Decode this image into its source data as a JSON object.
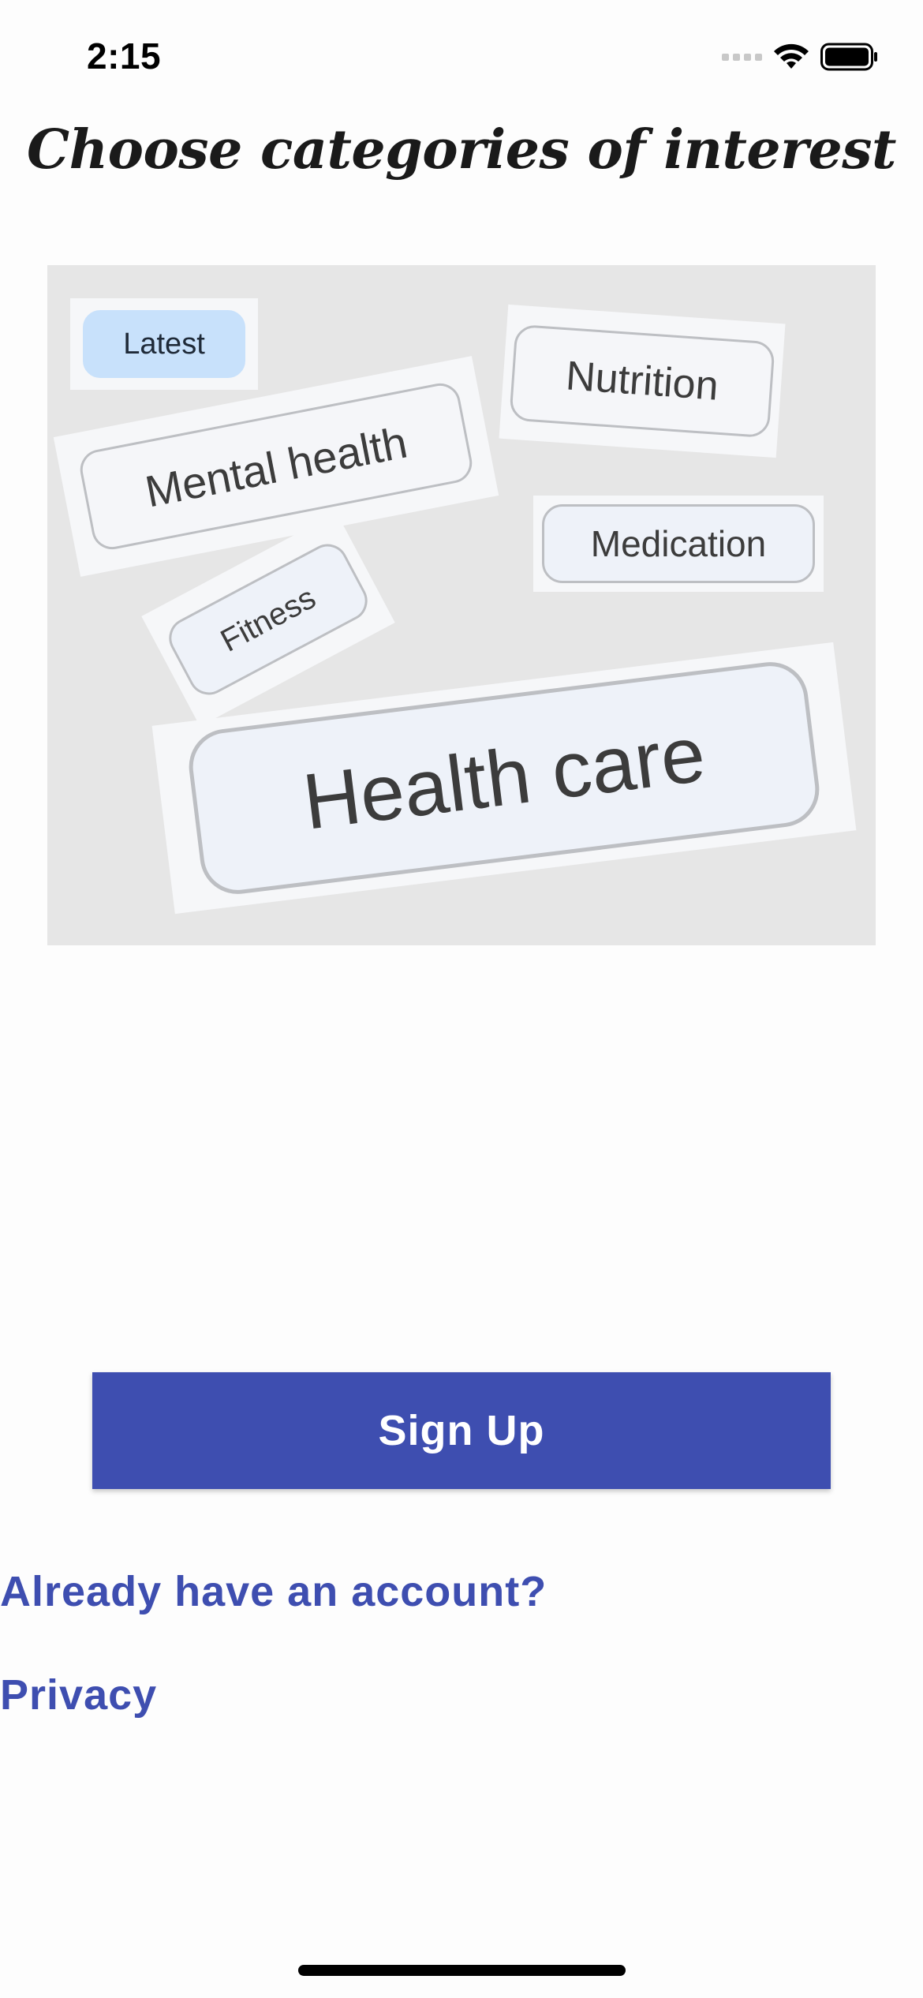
{
  "status_bar": {
    "time": "2:15",
    "icons": [
      "signal-icon",
      "wifi-icon",
      "battery-icon"
    ]
  },
  "title": "Choose categories of interest",
  "illustration": {
    "chips": [
      {
        "label": "Latest",
        "selected": true
      },
      {
        "label": "Nutrition",
        "selected": false
      },
      {
        "label": "Mental health",
        "selected": false
      },
      {
        "label": "Medication",
        "selected": false
      },
      {
        "label": "Fitness",
        "selected": false
      },
      {
        "label": "Health care",
        "selected": false
      }
    ]
  },
  "actions": {
    "signup_label": "Sign Up",
    "login_link": "Already have an account?",
    "privacy_link": "Privacy"
  },
  "colors": {
    "accent": "#3e4eb0",
    "selected_chip": "#c8e1fb",
    "illustration_bg": "#e6e6e6"
  }
}
